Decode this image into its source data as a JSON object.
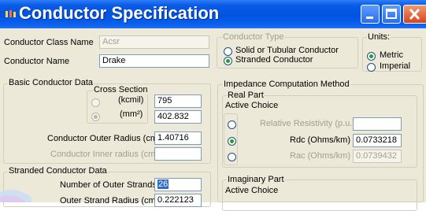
{
  "window": {
    "title": "Conductor Specification",
    "icon": "app-icon"
  },
  "conductor_class": {
    "label": "Conductor Class Name",
    "value": "Acsr"
  },
  "conductor_name": {
    "label": "Conductor Name",
    "value": "Drake"
  },
  "conductor_type": {
    "title": "Conductor Type",
    "options": [
      "Solid or Tubular Conductor",
      "Stranded Conductor"
    ],
    "selected": 1
  },
  "units": {
    "title": "Units:",
    "options": [
      "Metric",
      "Imperial"
    ],
    "selected": 0
  },
  "basic_data": {
    "title": "Basic Conductor Data",
    "cross_section": {
      "title": "Cross Section",
      "kcmil_label": "(kcmil)",
      "kcmil_value": "795",
      "mm2_label": "(mm²)",
      "mm2_value": "402.832",
      "selected": "mm2"
    },
    "outer_radius": {
      "label": "Conductor Outer Radius (cm)",
      "value": "1.40716"
    },
    "inner_radius": {
      "label": "Conductor Inner radius  (cm)",
      "value": ""
    }
  },
  "impedance": {
    "title": "Impedance Computation Method",
    "real_part": {
      "title": "Real Part",
      "active_choice": "Active Choice",
      "rows": [
        {
          "label": "Relative Resistivity (p.u.)",
          "value": "",
          "selected": false,
          "enabled": false
        },
        {
          "label": "Rdc (Ohms/km)",
          "value": "0.0733218",
          "selected": true,
          "enabled": true
        },
        {
          "label": "Rac (Ohms/km)",
          "value": "0.0739432",
          "selected": false,
          "enabled": false
        }
      ]
    },
    "imaginary_part": {
      "title": "Imaginary Part",
      "active_choice": "Active Choice"
    }
  },
  "stranded_data": {
    "title": "Stranded Conductor Data",
    "outer_strands": {
      "label": "Number of Outer Strands",
      "value": "26"
    },
    "outer_strand_radius": {
      "label": "Outer Strand Radius (cm)",
      "value": "0.222123"
    }
  }
}
